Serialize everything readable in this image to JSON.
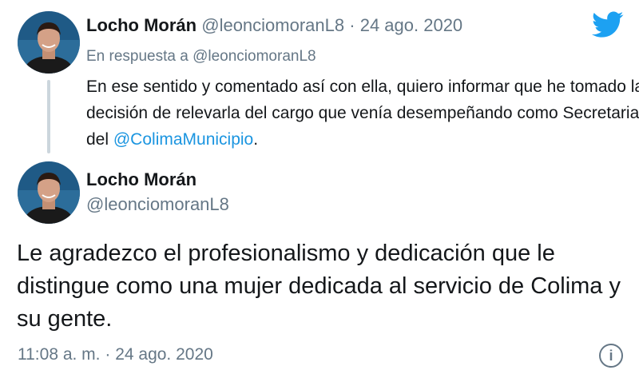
{
  "tweet1": {
    "name": "Locho Morán",
    "handle": "@leonciomoranL8",
    "separator": "·",
    "date": "24 ago. 2020",
    "reply_prefix": "En respuesta a",
    "reply_handle": "@leonciomoranL8",
    "text_before_mention": "En ese sentido y comentado así con ella, quiero informar que he tomado la decisión de relevarla del cargo que venía desempeñando como Secretaria del ",
    "mention": "@ColimaMunicipio",
    "text_after_mention": "."
  },
  "tweet2": {
    "name": "Locho Morán",
    "handle": "@leonciomoranL8",
    "text": "Le agradezco el profesionalismo y dedicación que le distingue como una mujer dedicada al servicio de Colima y su gente.",
    "time": "11:08 a. m.",
    "separator": "·",
    "date": "24 ago. 2020",
    "info_glyph": "i"
  },
  "icons": {
    "logo": "twitter-bird-icon",
    "info": "info-icon"
  },
  "colors": {
    "link": "#1b95e0",
    "brand": "#1da1f2",
    "muted": "#657786",
    "thread_line": "#ccd6dd"
  }
}
